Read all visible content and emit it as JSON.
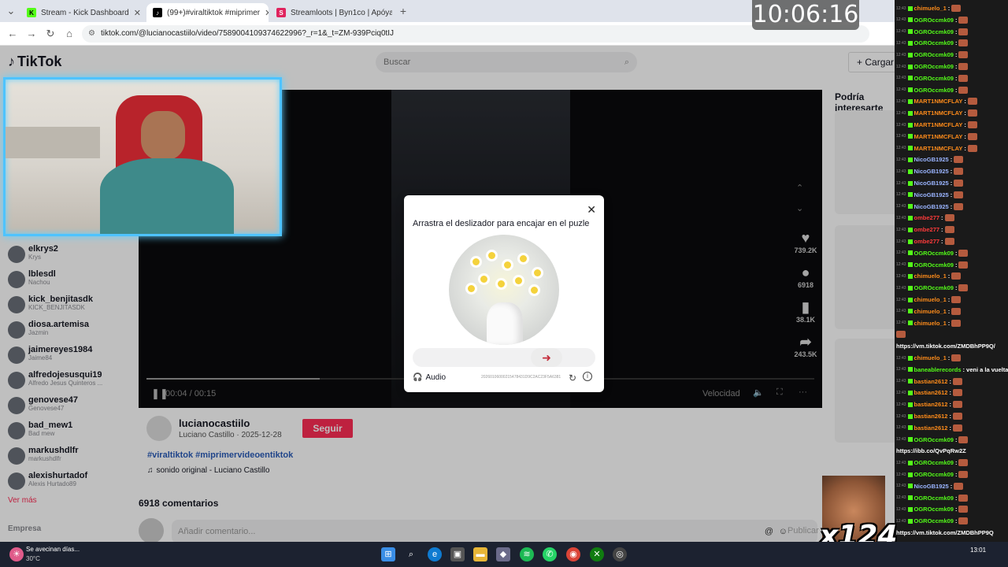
{
  "browser": {
    "tabs": [
      {
        "label": "Stream - Kick Dashboard",
        "color": "#53fc18",
        "glyph": "K"
      },
      {
        "label": "(99+)#viraltiktok #miprimer",
        "color": "#000000",
        "glyph": "♪"
      },
      {
        "label": "Streamloots | Byn1co | Apóyam",
        "color": "#e0245e",
        "glyph": "S"
      }
    ],
    "url": "tiktok.com/@lucianocastiilo/video/7589004109374622996?_r=1&_t=ZM-939Pciq0tIJ"
  },
  "clock": "10:06:16",
  "tiktok": {
    "logo": "TikTok",
    "search_placeholder": "Buscar",
    "upload_label": "Cargar",
    "recommended_title": "Podría interesarte",
    "following": [
      {
        "name": "elkrys2",
        "sub": "Krys"
      },
      {
        "name": "lblesdl",
        "sub": "Nachou"
      },
      {
        "name": "kick_benjitasdk",
        "sub": "KICK_BENJITASDK"
      },
      {
        "name": "diosa.artemisa",
        "sub": "Jazmin"
      },
      {
        "name": "jaimereyes1984",
        "sub": "Jaime84"
      },
      {
        "name": "alfredojesusqui19",
        "sub": "Alfredo Jesus Quinteros ..."
      },
      {
        "name": "genovese47",
        "sub": "Genovese47"
      },
      {
        "name": "bad_mew1",
        "sub": "Bad mew"
      },
      {
        "name": "markushdlfr",
        "sub": "markushdlfr"
      },
      {
        "name": "alexishurtadof",
        "sub": "Alexis Hurtado89"
      }
    ],
    "see_more": "Ver más",
    "company_label": "Empresa",
    "video": {
      "time": "00:04 / 00:15",
      "speed": "Velocidad",
      "likes": "739.2K",
      "comments": "6918",
      "saves": "38.1K",
      "shares": "243.5K"
    },
    "author": {
      "username": "lucianocastiilo",
      "display": "Luciano Castillo · 2025-12-28",
      "follow": "Seguir",
      "hashtags": "#viraltiktok #miprimervideoentiktok",
      "sound": "sonido original - Luciano Castillo"
    },
    "comments_count": "6918 comentarios",
    "comment_placeholder": "Añadir comentario...",
    "publish": "Publicar"
  },
  "captcha": {
    "title": "Arrastra el deslizador para encajar en el puzle",
    "audio": "Audio",
    "id_text": "20260106000215478431D9C2AC23F5A6381"
  },
  "taskbar": {
    "weather_title": "Se avecinan días...",
    "weather_temp": "30°C",
    "time": "13:01"
  },
  "meme_text": "x124",
  "chat": [
    {
      "user": "chimuelo_1",
      "color": "#ff8c1a",
      "msg": ""
    },
    {
      "user": "OGROccmk09",
      "color": "#53fc18",
      "msg": ""
    },
    {
      "user": "OGROccmk09",
      "color": "#53fc18",
      "msg": ""
    },
    {
      "user": "OGROccmk09",
      "color": "#53fc18",
      "msg": ""
    },
    {
      "user": "OGROccmk09",
      "color": "#53fc18",
      "msg": ""
    },
    {
      "user": "OGROccmk09",
      "color": "#53fc18",
      "msg": ""
    },
    {
      "user": "OGROccmk09",
      "color": "#53fc18",
      "msg": ""
    },
    {
      "user": "OGROccmk09",
      "color": "#53fc18",
      "msg": ""
    },
    {
      "user": "MART1NMCFLAY",
      "color": "#ff8c1a",
      "msg": ""
    },
    {
      "user": "MART1NMCFLAY",
      "color": "#ff8c1a",
      "msg": ""
    },
    {
      "user": "MART1NMCFLAY",
      "color": "#ff8c1a",
      "msg": ""
    },
    {
      "user": "MART1NMCFLAY",
      "color": "#ff8c1a",
      "msg": ""
    },
    {
      "user": "MART1NMCFLAY",
      "color": "#ff8c1a",
      "msg": ""
    },
    {
      "user": "NicoGB1925",
      "color": "#9ab4ff",
      "msg": ""
    },
    {
      "user": "NicoGB1925",
      "color": "#9ab4ff",
      "msg": ""
    },
    {
      "user": "NicoGB1925",
      "color": "#9ab4ff",
      "msg": ""
    },
    {
      "user": "NicoGB1925",
      "color": "#9ab4ff",
      "msg": ""
    },
    {
      "user": "NicoGB1925",
      "color": "#9ab4ff",
      "msg": ""
    },
    {
      "user": "ombe277",
      "color": "#ff3b3b",
      "msg": ""
    },
    {
      "user": "ombe277",
      "color": "#ff3b3b",
      "msg": ""
    },
    {
      "user": "ombe277",
      "color": "#ff3b3b",
      "msg": ""
    },
    {
      "user": "OGROccmk09",
      "color": "#53fc18",
      "msg": ""
    },
    {
      "user": "OGROccmk09",
      "color": "#53fc18",
      "msg": ""
    },
    {
      "user": "chimuelo_1",
      "color": "#ff8c1a",
      "msg": ""
    },
    {
      "user": "OGROccmk09",
      "color": "#53fc18",
      "msg": ""
    },
    {
      "user": "chimuelo_1",
      "color": "#ff8c1a",
      "msg": ""
    },
    {
      "user": "chimuelo_1",
      "color": "#ff8c1a",
      "msg": ""
    },
    {
      "user": "chimuelo_1",
      "color": "#ff8c1a",
      "msg": ""
    },
    {
      "user": "",
      "color": "#ff3b3b",
      "msg": ""
    },
    {
      "user": "",
      "color": "#ffffff",
      "msg": "https://vm.tiktok.com/ZMDBhPP9Q/"
    },
    {
      "user": "chimuelo_1",
      "color": "#ff8c1a",
      "msg": ""
    },
    {
      "user": "baneablerecords",
      "color": "#53fc18",
      "msg": "veni a la vuelta de la ruea"
    },
    {
      "user": "bastian2612",
      "color": "#ff8c1a",
      "msg": ""
    },
    {
      "user": "bastian2612",
      "color": "#ff8c1a",
      "msg": ""
    },
    {
      "user": "bastian2612",
      "color": "#ff8c1a",
      "msg": ""
    },
    {
      "user": "bastian2612",
      "color": "#ff8c1a",
      "msg": ""
    },
    {
      "user": "bastian2612",
      "color": "#ff8c1a",
      "msg": ""
    },
    {
      "user": "OGROccmk09",
      "color": "#53fc18",
      "msg": ""
    },
    {
      "user": "",
      "color": "#ffffff",
      "msg": "https://ibb.co/QvPqRw2Z"
    },
    {
      "user": "OGROccmk09",
      "color": "#53fc18",
      "msg": ""
    },
    {
      "user": "OGROccmk09",
      "color": "#53fc18",
      "msg": ""
    },
    {
      "user": "NicoGB1925",
      "color": "#9ab4ff",
      "msg": ""
    },
    {
      "user": "OGROccmk09",
      "color": "#53fc18",
      "msg": ""
    },
    {
      "user": "OGROccmk09",
      "color": "#53fc18",
      "msg": ""
    },
    {
      "user": "OGROccmk09",
      "color": "#53fc18",
      "msg": ""
    },
    {
      "user": "",
      "color": "#ffffff",
      "msg": "https://vm.tiktok.com/ZMDBhPP9Q"
    }
  ]
}
